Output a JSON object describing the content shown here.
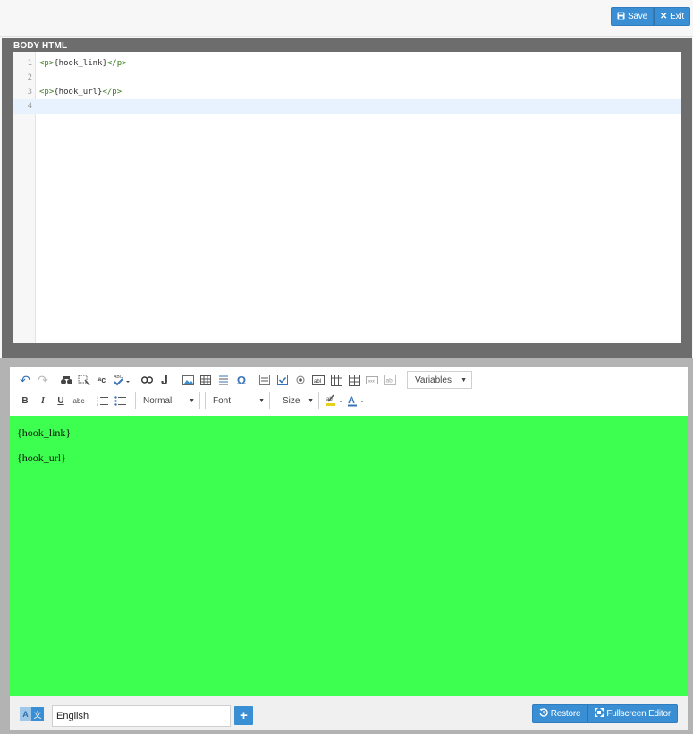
{
  "header": {
    "save_label": "Save",
    "exit_label": "Exit"
  },
  "html_panel": {
    "title": "BODY HTML",
    "lines": [
      {
        "num": "1",
        "open": "<p>",
        "content": "{hook_link}",
        "close": "</p>"
      },
      {
        "num": "2",
        "open": "",
        "content": "",
        "close": ""
      },
      {
        "num": "3",
        "open": "<p>",
        "content": "{hook_url}",
        "close": "</p>"
      },
      {
        "num": "4",
        "open": "",
        "content": "",
        "close": ""
      }
    ]
  },
  "toolbar": {
    "variables_label": "Variables",
    "format_label": "Normal",
    "font_label": "Font",
    "size_label": "Size",
    "bold": "B",
    "italic": "I",
    "underline": "U",
    "strike": "abc"
  },
  "editor": {
    "paragraphs": [
      "{hook_link}",
      "{hook_url}"
    ],
    "background_color": "#3cff50"
  },
  "footer": {
    "language_value": "English",
    "add_label": "+",
    "restore_label": "Restore",
    "fullscreen_label": "Fullscreen Editor"
  },
  "colors": {
    "accent": "#3a8fd4",
    "panel_dark": "#6d6d6d"
  }
}
